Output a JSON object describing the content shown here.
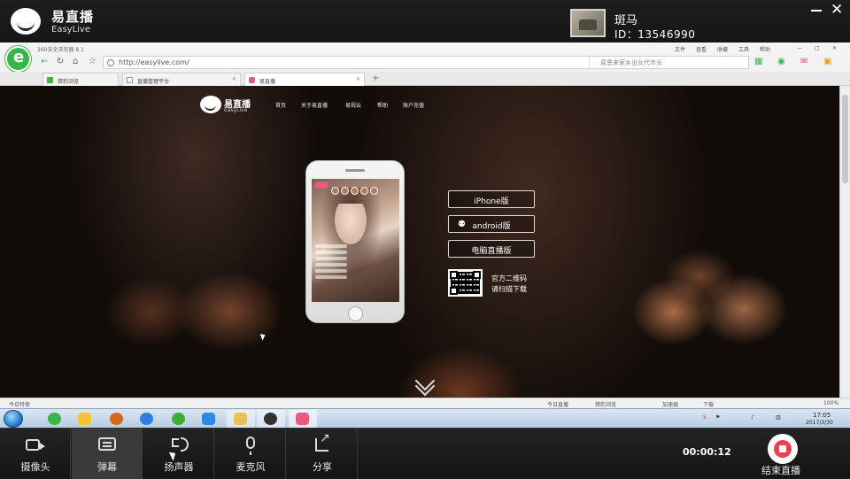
{
  "app": {
    "name": "易直播",
    "name_en": "EasyLive",
    "user_name": "斑马",
    "user_id": "ID：13546990"
  },
  "browser": {
    "title": "360安全浏览器 8.1",
    "menu": [
      "文件",
      "查看",
      "收藏",
      "工具",
      "帮助"
    ],
    "url": "http://easylive.com/",
    "search_placeholder": "周恩来家乡出女代市长",
    "tabs": [
      {
        "label": "猎豹浏览",
        "active": false
      },
      {
        "label": "直播管理平台",
        "active": false
      },
      {
        "label": "易直播",
        "active": true
      }
    ],
    "status_left": "今日特卖",
    "status_items": [
      "今日直播",
      "猎豹浏览",
      "加速器",
      "下载",
      "100%"
    ]
  },
  "site": {
    "logo_name": "易直播",
    "logo_name_en": "EasyLive",
    "nav": [
      "首页",
      "关于易直播",
      "易视云",
      "帮助",
      "账户充值"
    ],
    "buttons": {
      "iphone": "iPhone版",
      "android": "android版",
      "pc": "电脑直播版"
    },
    "qr_text_1": "官方二维码",
    "qr_text_2": "请扫描下载"
  },
  "taskbar": {
    "time": "17:05",
    "date": "2017/3/30"
  },
  "controls": {
    "camera": "摄像头",
    "danmaku": "弹幕",
    "speaker": "扬声器",
    "mic": "麦克风",
    "share": "分享",
    "timer": "00:00:12",
    "end": "结束直播"
  },
  "colors": {
    "accent_red": "#e8424d",
    "browser_green": "#3ab54a"
  }
}
